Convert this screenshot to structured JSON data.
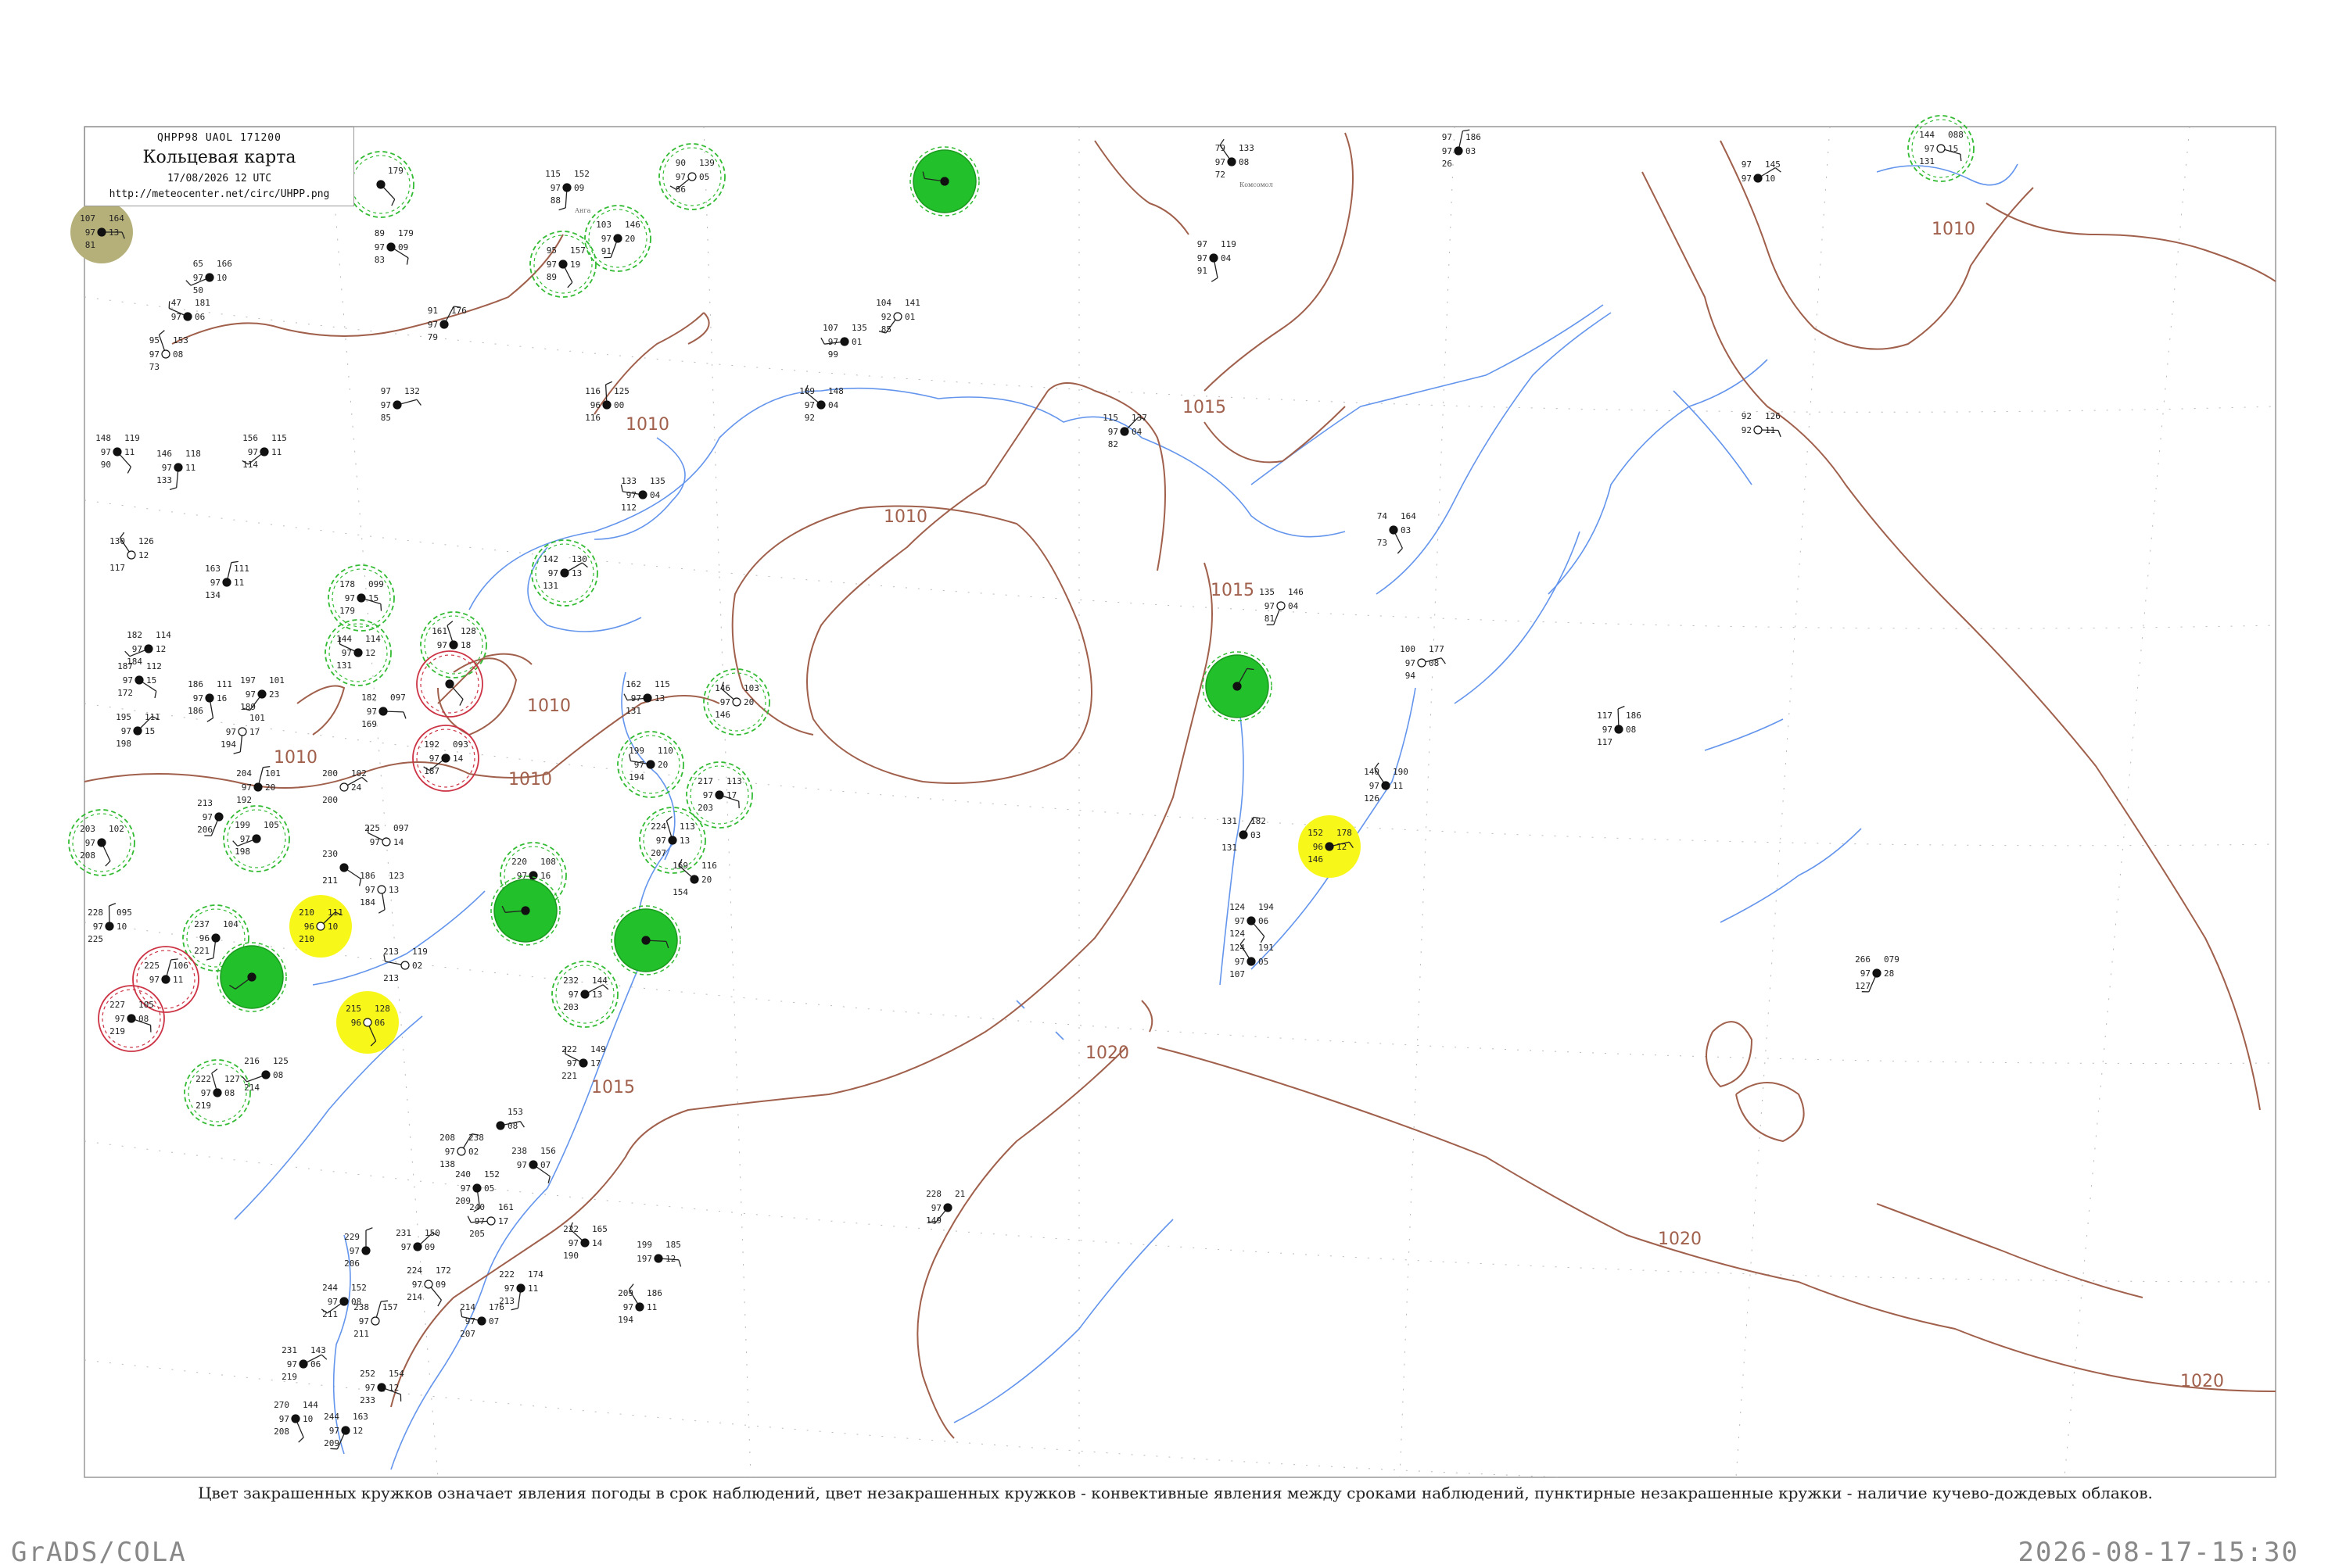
{
  "header": {
    "code": "QHPP98  UAOL  171200",
    "title": "Кольцевая карта",
    "date": "17/08/2026 12 UTC",
    "url": "http://meteocenter.net/circ/UHPP.png"
  },
  "caption": "Цвет закрашенных кружков означает явления погоды в срок наблюдений, цвет незакрашенных кружков - конвективные явления между сроками наблюдений, пунктирные незакрашенные кружки - наличие кучево-дождевых облаков.",
  "footer": {
    "left": "GrADS/COLA",
    "right": "2026-08-17-15:30"
  },
  "colors": {
    "coast": "#6495ed",
    "isobar": "#a0604c",
    "halo_green": "#33bb33",
    "fill_green": "#22c02a",
    "fill_yellow": "#f7f71a",
    "fill_olive": "#b5b07a",
    "halo_red": "#cc3344"
  },
  "isobar_labels": [
    {
      "text": "1010"
    },
    {
      "text": "1015"
    },
    {
      "text": "1010"
    },
    {
      "text": "1015"
    },
    {
      "text": "1010"
    },
    {
      "text": "1010"
    },
    {
      "text": "1010"
    },
    {
      "text": "1020"
    },
    {
      "text": "1020"
    },
    {
      "text": "1020"
    },
    {
      "text": "1015"
    },
    {
      "text": "1010"
    }
  ],
  "stations": [
    {
      "id": "s1",
      "tl": "107",
      "ml": "97",
      "bl": "81",
      "tr": "164",
      "mr": "13",
      "fill": "olive"
    },
    {
      "id": "s2",
      "tl": "",
      "ml": "",
      "bl": "",
      "tr": "179",
      "mr": "",
      "halo": "green"
    },
    {
      "id": "s3",
      "tl": "115",
      "ml": "97",
      "bl": "88",
      "tr": "152",
      "mr": "09",
      "name": "Анга"
    },
    {
      "id": "s4",
      "tl": "90",
      "ml": "97",
      "bl": "86",
      "tr": "139",
      "mr": "05",
      "halo": "green"
    },
    {
      "id": "s5",
      "tl": "",
      "ml": "",
      "bl": "",
      "tr": "",
      "mr": "",
      "fill": "green"
    },
    {
      "id": "s6",
      "tl": "79",
      "ml": "97",
      "bl": "72",
      "tr": "133",
      "mr": "08",
      "name": "Комсомол"
    },
    {
      "id": "s7",
      "tl": "97",
      "ml": "97",
      "bl": "26",
      "tr": "186",
      "mr": "03"
    },
    {
      "id": "s8",
      "tl": "97",
      "ml": "97",
      "bl": "",
      "tr": "145",
      "mr": "10"
    },
    {
      "id": "s9",
      "tl": "144",
      "ml": "97",
      "bl": "131",
      "tr": "088",
      "mr": "15",
      "halo": "green"
    },
    {
      "id": "s10",
      "tl": "95",
      "ml": "97",
      "bl": "89",
      "tr": "157",
      "mr": "19",
      "halo": "green"
    },
    {
      "id": "s11",
      "tl": "103",
      "ml": "97",
      "bl": "91",
      "tr": "146",
      "mr": "20",
      "halo": "green"
    },
    {
      "id": "s12",
      "tl": "65",
      "ml": "97",
      "bl": "50",
      "tr": "166",
      "mr": "10"
    },
    {
      "id": "s13",
      "tl": "47",
      "ml": "97",
      "bl": "",
      "tr": "181",
      "mr": "06"
    },
    {
      "id": "s14",
      "tl": "95",
      "ml": "97",
      "bl": "73",
      "tr": "153",
      "mr": "08"
    },
    {
      "id": "s15",
      "tl": "91",
      "ml": "97",
      "bl": "79",
      "tr": "176",
      "mr": ""
    },
    {
      "id": "s16",
      "tl": "97",
      "ml": "97",
      "bl": "85",
      "tr": "132",
      "mr": ""
    },
    {
      "id": "s17",
      "tl": "89",
      "ml": "97",
      "bl": "83",
      "tr": "179",
      "mr": "09"
    },
    {
      "id": "s18",
      "tl": "97",
      "ml": "97",
      "bl": "91",
      "tr": "119",
      "mr": "04"
    },
    {
      "id": "s19",
      "tl": "104",
      "ml": "92",
      "bl": "85",
      "tr": "141",
      "mr": "01"
    },
    {
      "id": "s20",
      "tl": "107",
      "ml": "97",
      "bl": "99",
      "tr": "135",
      "mr": "01"
    },
    {
      "id": "s21",
      "tl": "109",
      "ml": "97",
      "bl": "92",
      "tr": "148",
      "mr": "04"
    },
    {
      "id": "s22",
      "tl": "116",
      "ml": "96",
      "bl": "116",
      "tr": "125",
      "mr": "00"
    },
    {
      "id": "s23",
      "tl": "115",
      "ml": "97",
      "bl": "82",
      "tr": "137",
      "mr": "04"
    },
    {
      "id": "s24",
      "tl": "92",
      "ml": "92",
      "bl": "",
      "tr": "126",
      "mr": "11"
    },
    {
      "id": "s25",
      "tl": "148",
      "ml": "97",
      "bl": "90",
      "tr": "119",
      "mr": "11"
    },
    {
      "id": "s26",
      "tl": "146",
      "ml": "97",
      "bl": "133",
      "tr": "118",
      "mr": "11"
    },
    {
      "id": "s27",
      "tl": "156",
      "ml": "97",
      "bl": "114",
      "tr": "115",
      "mr": "11"
    },
    {
      "id": "s28",
      "tl": "133",
      "ml": "97",
      "bl": "112",
      "tr": "135",
      "mr": "04"
    },
    {
      "id": "s29",
      "tl": "130",
      "ml": "",
      "bl": "117",
      "tr": "126",
      "mr": "12"
    },
    {
      "id": "s30",
      "tl": "163",
      "ml": "97",
      "bl": "134",
      "tr": "111",
      "mr": "11"
    },
    {
      "id": "s31",
      "tl": "142",
      "ml": "97",
      "bl": "131",
      "tr": "130",
      "mr": "13",
      "halo": "green"
    },
    {
      "id": "s32",
      "tl": "178",
      "ml": "97",
      "bl": "179",
      "tr": "099",
      "mr": "15",
      "halo": "green"
    },
    {
      "id": "s33",
      "tl": "74",
      "ml": "",
      "bl": "73",
      "tr": "164",
      "mr": "03"
    },
    {
      "id": "s34",
      "tl": "135",
      "ml": "97",
      "bl": "81",
      "tr": "146",
      "mr": "04"
    },
    {
      "id": "s35",
      "tl": "182",
      "ml": "97",
      "bl": "184",
      "tr": "114",
      "mr": "12"
    },
    {
      "id": "s36",
      "tl": "144",
      "ml": "97",
      "bl": "131",
      "tr": "114",
      "mr": "12",
      "halo": "green"
    },
    {
      "id": "s37",
      "tl": "161",
      "ml": "97",
      "bl": "",
      "tr": "128",
      "mr": "18",
      "halo": "green"
    },
    {
      "id": "s38",
      "tl": "",
      "ml": "",
      "bl": "",
      "tr": "",
      "mr": "",
      "fill": "green"
    },
    {
      "id": "s39",
      "tl": "100",
      "ml": "97",
      "bl": "94",
      "tr": "177",
      "mr": "08"
    },
    {
      "id": "s40",
      "tl": "187",
      "ml": "97",
      "bl": "172",
      "tr": "112",
      "mr": "15"
    },
    {
      "id": "s41",
      "tl": "186",
      "ml": "97",
      "bl": "186",
      "tr": "111",
      "mr": "16"
    },
    {
      "id": "s42",
      "tl": "197",
      "ml": "97",
      "bl": "189",
      "tr": "101",
      "mr": "23"
    },
    {
      "id": "s43",
      "tl": "162",
      "ml": "97",
      "bl": "131",
      "tr": "115",
      "mr": "13"
    },
    {
      "id": "s44",
      "tl": "146",
      "ml": "97",
      "bl": "146",
      "tr": "103",
      "mr": "20",
      "halo": "green"
    },
    {
      "id": "s45",
      "tl": "117",
      "ml": "97",
      "bl": "117",
      "tr": "186",
      "mr": "08"
    },
    {
      "id": "s46",
      "tl": "195",
      "ml": "97",
      "bl": "198",
      "tr": "111",
      "mr": "15"
    },
    {
      "id": "s47",
      "tl": "182",
      "ml": "97",
      "bl": "169",
      "tr": "097",
      "mr": ""
    },
    {
      "id": "s48",
      "tl": "",
      "ml": "",
      "bl": "",
      "tr": "",
      "mr": "",
      "halo": "red"
    },
    {
      "id": "s49",
      "tl": "",
      "ml": "97",
      "bl": "194",
      "tr": "101",
      "mr": "17"
    },
    {
      "id": "s50",
      "tl": "192",
      "ml": "97",
      "bl": "187",
      "tr": "093",
      "mr": "14",
      "halo": "red"
    },
    {
      "id": "s51",
      "tl": "199",
      "ml": "97",
      "bl": "194",
      "tr": "110",
      "mr": "20",
      "halo": "green"
    },
    {
      "id": "s52",
      "tl": "140",
      "ml": "97",
      "bl": "126",
      "tr": "190",
      "mr": "11"
    },
    {
      "id": "s53",
      "tl": "204",
      "ml": "97",
      "bl": "192",
      "tr": "101",
      "mr": "20"
    },
    {
      "id": "s54",
      "tl": "200",
      "ml": "",
      "bl": "200",
      "tr": "102",
      "mr": "24"
    },
    {
      "id": "s55",
      "tl": "217",
      "ml": "97",
      "bl": "203",
      "tr": "113",
      "mr": "17",
      "halo": "green"
    },
    {
      "id": "s56",
      "tl": "203",
      "ml": "97",
      "bl": "208",
      "tr": "102",
      "mr": "",
      "halo": "green"
    },
    {
      "id": "s57",
      "tl": "213",
      "ml": "97",
      "bl": "206",
      "tr": "",
      "mr": ""
    },
    {
      "id": "s58",
      "tl": "199",
      "ml": "97",
      "bl": "198",
      "tr": "105",
      "mr": "",
      "halo": "green"
    },
    {
      "id": "s59",
      "tl": "225",
      "ml": "97",
      "bl": "",
      "tr": "097",
      "mr": "14"
    },
    {
      "id": "s60",
      "tl": "224",
      "ml": "97",
      "bl": "207",
      "tr": "113",
      "mr": "13",
      "halo": "green"
    },
    {
      "id": "s61",
      "tl": "131",
      "ml": "",
      "bl": "131",
      "tr": "182",
      "mr": "03"
    },
    {
      "id": "s62",
      "tl": "152",
      "ml": "96",
      "bl": "146",
      "tr": "178",
      "mr": "12",
      "fill": "yellow"
    },
    {
      "id": "s63",
      "tl": "230",
      "ml": "",
      "bl": "211",
      "tr": "",
      "mr": ""
    },
    {
      "id": "s64",
      "tl": "186",
      "ml": "97",
      "bl": "184",
      "tr": "123",
      "mr": "13"
    },
    {
      "id": "s65",
      "tl": "220",
      "ml": "97",
      "bl": "219",
      "tr": "108",
      "mr": "16",
      "halo": "green"
    },
    {
      "id": "s66",
      "tl": "",
      "ml": "",
      "bl": "",
      "tr": "",
      "mr": "",
      "fill": "green"
    },
    {
      "id": "s67",
      "tl": "169",
      "ml": "",
      "bl": "154",
      "tr": "116",
      "mr": "20"
    },
    {
      "id": "s68",
      "tl": "228",
      "ml": "97",
      "bl": "225",
      "tr": "095",
      "mr": "10"
    },
    {
      "id": "s69",
      "tl": "210",
      "ml": "96",
      "bl": "210",
      "tr": "111",
      "mr": "10",
      "fill": "yellow"
    },
    {
      "id": "s70",
      "tl": "",
      "ml": "",
      "bl": "",
      "tr": "",
      "mr": "",
      "fill": "green"
    },
    {
      "id": "s71",
      "tl": "124",
      "ml": "97",
      "bl": "124",
      "tr": "194",
      "mr": "06"
    },
    {
      "id": "s72",
      "tl": "237",
      "ml": "96",
      "bl": "221",
      "tr": "104",
      "mr": "",
      "halo": "green"
    },
    {
      "id": "s73",
      "tl": "",
      "ml": "",
      "bl": "",
      "tr": "",
      "mr": "",
      "fill": "green"
    },
    {
      "id": "s74",
      "tl": "213",
      "ml": "",
      "bl": "213",
      "tr": "119",
      "mr": "02"
    },
    {
      "id": "s75",
      "tl": "124",
      "ml": "97",
      "bl": "107",
      "tr": "191",
      "mr": "05"
    },
    {
      "id": "s76",
      "tl": "225",
      "ml": "97",
      "bl": "",
      "tr": "106",
      "mr": "11",
      "halo": "red"
    },
    {
      "id": "s77",
      "tl": "232",
      "ml": "97",
      "bl": "203",
      "tr": "144",
      "mr": "13",
      "halo": "green"
    },
    {
      "id": "s78",
      "tl": "227",
      "ml": "97",
      "bl": "219",
      "tr": "105",
      "mr": "08",
      "halo": "red"
    },
    {
      "id": "s79",
      "tl": "215",
      "ml": "96",
      "bl": "",
      "tr": "128",
      "mr": "06",
      "fill": "yellow"
    },
    {
      "id": "s80",
      "tl": "266",
      "ml": "97",
      "bl": "127",
      "tr": "079",
      "mr": "28"
    },
    {
      "id": "s81",
      "tl": "216",
      "ml": "",
      "bl": "214",
      "tr": "125",
      "mr": "08"
    },
    {
      "id": "s82",
      "tl": "222",
      "ml": "97",
      "bl": "221",
      "tr": "149",
      "mr": "17"
    },
    {
      "id": "s83",
      "tl": "222",
      "ml": "97",
      "bl": "219",
      "tr": "127",
      "mr": "08",
      "halo": "green"
    },
    {
      "id": "s84",
      "tl": "208",
      "ml": "97",
      "bl": "138",
      "tr": "238",
      "mr": "02"
    },
    {
      "id": "s85",
      "tl": "",
      "ml": "",
      "bl": "",
      "tr": "153",
      "mr": "08"
    },
    {
      "id": "s86",
      "tl": "238",
      "ml": "97",
      "bl": "",
      "tr": "156",
      "mr": "07"
    },
    {
      "id": "s87",
      "tl": "240",
      "ml": "97",
      "bl": "209",
      "tr": "152",
      "mr": "05"
    },
    {
      "id": "s88",
      "tl": "228",
      "ml": "97",
      "bl": "149",
      "tr": "21",
      "mr": ""
    },
    {
      "id": "s89",
      "tl": "240",
      "ml": "97",
      "bl": "205",
      "tr": "161",
      "mr": "17"
    },
    {
      "id": "s90",
      "tl": "222",
      "ml": "97",
      "bl": "190",
      "tr": "165",
      "mr": "14"
    },
    {
      "id": "s91",
      "tl": "229",
      "ml": "97",
      "bl": "206",
      "tr": "",
      "mr": ""
    },
    {
      "id": "s92",
      "tl": "231",
      "ml": "97",
      "bl": "",
      "tr": "150",
      "mr": "09"
    },
    {
      "id": "s93",
      "tl": "199",
      "ml": "197",
      "bl": "",
      "tr": "185",
      "mr": "12"
    },
    {
      "id": "s94",
      "tl": "224",
      "ml": "97",
      "bl": "214",
      "tr": "172",
      "mr": "09"
    },
    {
      "id": "s95",
      "tl": "222",
      "ml": "97",
      "bl": "213",
      "tr": "174",
      "mr": "11"
    },
    {
      "id": "s96",
      "tl": "244",
      "ml": "97",
      "bl": "211",
      "tr": "152",
      "mr": "08"
    },
    {
      "id": "s97",
      "tl": "214",
      "ml": "97",
      "bl": "207",
      "tr": "176",
      "mr": "07"
    },
    {
      "id": "s98",
      "tl": "209",
      "ml": "97",
      "bl": "194",
      "tr": "186",
      "mr": "11"
    },
    {
      "id": "s99",
      "tl": "238",
      "ml": "97",
      "bl": "211",
      "tr": "157",
      "mr": ""
    },
    {
      "id": "s100",
      "tl": "231",
      "ml": "97",
      "bl": "219",
      "tr": "143",
      "mr": "06"
    },
    {
      "id": "s101",
      "tl": "252",
      "ml": "97",
      "bl": "233",
      "tr": "154",
      "mr": "12"
    },
    {
      "id": "s102",
      "tl": "270",
      "ml": "97",
      "bl": "208",
      "tr": "144",
      "mr": "10"
    },
    {
      "id": "s103",
      "tl": "244",
      "ml": "97",
      "bl": "209",
      "tr": "163",
      "mr": "12"
    }
  ]
}
